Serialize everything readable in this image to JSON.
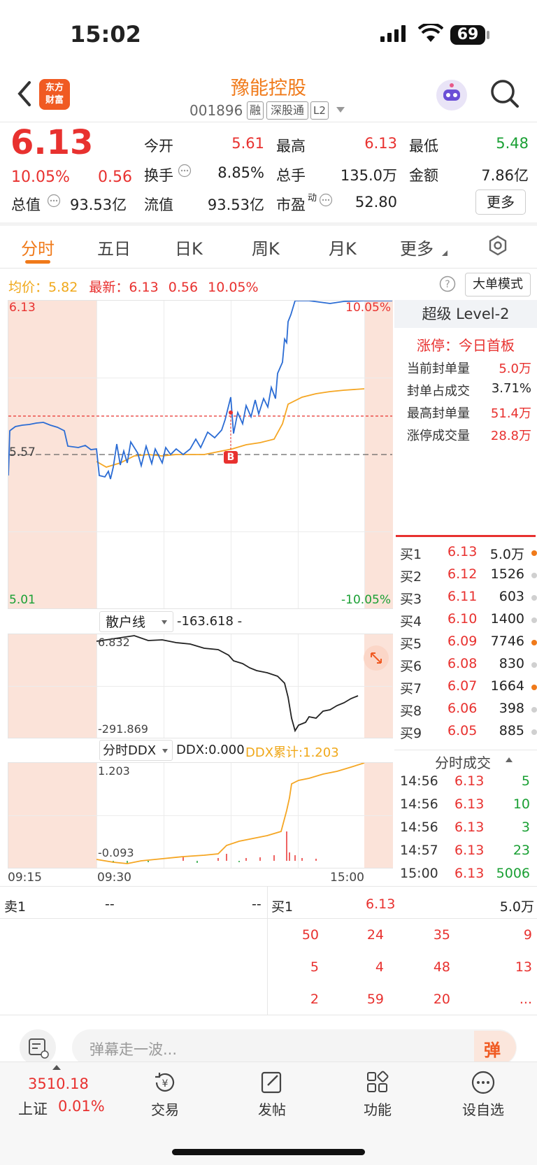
{
  "status_bar": {
    "time": "15:02",
    "battery": "69"
  },
  "header": {
    "title": "豫能控股",
    "code": "001896",
    "tags": [
      "融",
      "深股通",
      "L2"
    ]
  },
  "quote": {
    "price": "6.13",
    "pct": "10.05%",
    "change": "0.56",
    "items": [
      {
        "label": "今开",
        "value": "5.61",
        "color": "#e8312f"
      },
      {
        "label": "最高",
        "value": "6.13",
        "color": "#e8312f"
      },
      {
        "label": "最低",
        "value": "5.48",
        "color": "#1aa034"
      },
      {
        "label": "换手",
        "value": "8.85%",
        "color": "#222"
      },
      {
        "label": "总手",
        "value": "135.0万",
        "color": "#222"
      },
      {
        "label": "金额",
        "value": "7.86亿",
        "color": "#222"
      },
      {
        "label": "总值",
        "value": "93.53亿",
        "color": "#222"
      },
      {
        "label": "流值",
        "value": "93.53亿",
        "color": "#222"
      },
      {
        "label": "市盈",
        "sup": "动",
        "value": "52.80",
        "color": "#222"
      }
    ],
    "more_button": "更多"
  },
  "tabs": [
    "分时",
    "五日",
    "日K",
    "周K",
    "月K",
    "更多"
  ],
  "info_line": {
    "avg_label": "均价：",
    "avg_value": "5.82",
    "latest_label": "最新：",
    "latest_value": "6.13",
    "latest_change": "0.56",
    "latest_pct": "10.05%",
    "mode_button": "大单模式"
  },
  "main_chart": {
    "top_left": "6.13",
    "top_right": "10.05%",
    "mid_left": "5.57",
    "bottom_left": "5.01",
    "bottom_right": "-10.05%",
    "time_labels": [
      "09:15",
      "09:30",
      "15:00"
    ],
    "marker": "B"
  },
  "retail_chart": {
    "selector": "散户线",
    "value": "-163.618 -",
    "top": "6.832",
    "bottom": "-291.869"
  },
  "ddx_chart": {
    "selector": "分时DDX",
    "ddx_label": "DDX:0.000",
    "cum_label": "DDX累计:1.203",
    "top": "1.203",
    "bottom": "-0.093"
  },
  "level2": {
    "title": "超级 Level-2",
    "limit_label": "涨停：今日首板",
    "rows": [
      {
        "label": "当前封单量",
        "value": "5.0万",
        "color": "#e8312f"
      },
      {
        "label": "封单占成交",
        "value": "3.71%",
        "color": "#222"
      },
      {
        "label": "最高封单量",
        "value": "51.4万",
        "color": "#e8312f"
      },
      {
        "label": "涨停成交量",
        "value": "28.8万",
        "color": "#e8312f"
      }
    ]
  },
  "bids": [
    {
      "label": "买1",
      "price": "6.13",
      "vol": "5.0万",
      "dot": "#f07a1a"
    },
    {
      "label": "买2",
      "price": "6.12",
      "vol": "1526",
      "dot": "#d0d0d0"
    },
    {
      "label": "买3",
      "price": "6.11",
      "vol": "603",
      "dot": "#d0d0d0"
    },
    {
      "label": "买4",
      "price": "6.10",
      "vol": "1400",
      "dot": "#d0d0d0"
    },
    {
      "label": "买5",
      "price": "6.09",
      "vol": "7746",
      "dot": "#f07a1a"
    },
    {
      "label": "买6",
      "price": "6.08",
      "vol": "830",
      "dot": "#d0d0d0"
    },
    {
      "label": "买7",
      "price": "6.07",
      "vol": "1664",
      "dot": "#f07a1a"
    },
    {
      "label": "买8",
      "price": "6.06",
      "vol": "398",
      "dot": "#d0d0d0"
    },
    {
      "label": "买9",
      "price": "6.05",
      "vol": "885",
      "dot": "#d0d0d0"
    }
  ],
  "trades": {
    "title": "分时成交",
    "rows": [
      {
        "time": "14:56",
        "price": "6.13",
        "vol": "5",
        "color": "#1aa034"
      },
      {
        "time": "14:56",
        "price": "6.13",
        "vol": "10",
        "color": "#1aa034"
      },
      {
        "time": "14:56",
        "price": "6.13",
        "vol": "3",
        "color": "#1aa034"
      },
      {
        "time": "14:57",
        "price": "6.13",
        "vol": "23",
        "color": "#1aa034"
      },
      {
        "time": "15:00",
        "price": "6.13",
        "vol": "5006",
        "color": "#1aa034"
      }
    ]
  },
  "queue": {
    "sell_label": "卖1",
    "sell_price": "--",
    "sell_vol": "--",
    "buy_label": "买1",
    "buy_price": "6.13",
    "buy_vol": "5.0万",
    "grid": [
      [
        "50",
        "24",
        "35",
        "9"
      ],
      [
        "5",
        "4",
        "48",
        "13"
      ],
      [
        "2",
        "59",
        "20",
        "..."
      ]
    ]
  },
  "comment_bar": {
    "placeholder": "弹幕走一波...",
    "button": "弹"
  },
  "bottom_nav": {
    "index_value": "3510.18",
    "index_name": "上证",
    "index_pct": "0.01%",
    "items": [
      "交易",
      "发帖",
      "功能",
      "设自选"
    ]
  }
}
